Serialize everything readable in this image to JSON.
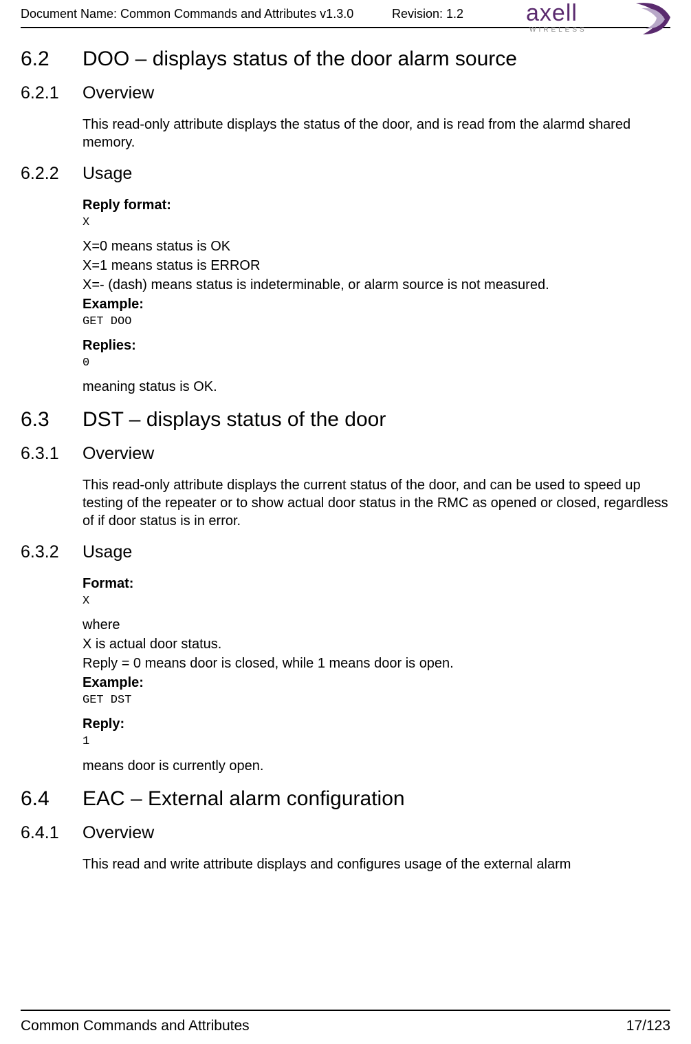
{
  "header": {
    "doc_name": "Document Name: Common Commands and Attributes v1.3.0",
    "revision": "Revision: 1.2",
    "logo_text": "axell",
    "logo_sub": "WIRELESS"
  },
  "s62": {
    "num": "6.2",
    "title": "DOO – displays status of the door alarm source"
  },
  "s621": {
    "num": "6.2.1",
    "title": "Overview",
    "body": "This read-only attribute displays the status of the door, and is read from the alarmd shared memory."
  },
  "s622": {
    "num": "6.2.2",
    "title": "Usage",
    "reply_format_label": "Reply format:",
    "reply_format_code": "X",
    "x0": "X=0 means status is OK",
    "x1": "X=1 means status is ERROR",
    "xdash": "X=- (dash) means status is indeterminable, or alarm source is not measured.",
    "example_label": "Example:",
    "example_code": "GET DOO",
    "replies_label": "Replies:",
    "replies_code": "0",
    "meaning": "meaning status is OK."
  },
  "s63": {
    "num": "6.3",
    "title": "DST – displays status of the door"
  },
  "s631": {
    "num": "6.3.1",
    "title": "Overview",
    "body": "This read-only attribute displays the current status of the door, and can be used to speed up testing of the repeater or to show actual door status in the RMC as opened or closed, regardless of if door status is in error."
  },
  "s632": {
    "num": "6.3.2",
    "title": "Usage",
    "format_label": "Format:",
    "format_code": "X",
    "where": "where",
    "xactual": "X is actual door status.",
    "reply_desc": "Reply = 0 means door is closed, while 1 means door is open.",
    "example_label": "Example:",
    "example_code": "GET DST",
    "reply_label": "Reply:",
    "reply_code": "1",
    "means": "means door is currently open."
  },
  "s64": {
    "num": "6.4",
    "title": "EAC – External alarm configuration"
  },
  "s641": {
    "num": "6.4.1",
    "title": "Overview",
    "body": "This read and write attribute displays and configures usage of the external alarm"
  },
  "footer": {
    "left": "Common Commands and Attributes",
    "right": "17/123"
  }
}
